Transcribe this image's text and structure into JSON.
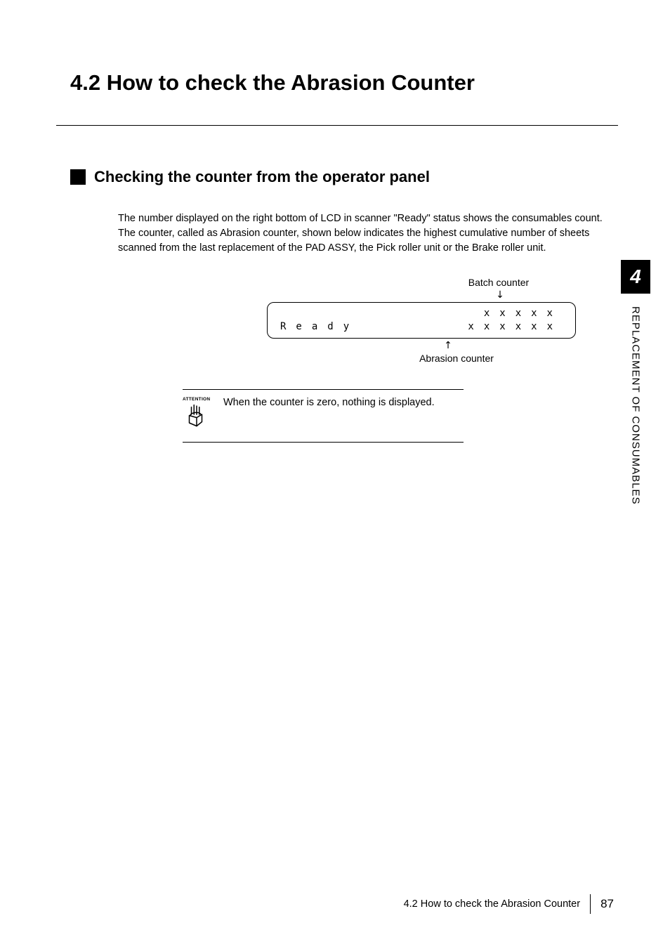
{
  "title": "4.2  How to check the Abrasion Counter",
  "section": {
    "heading": "Checking the counter from the operator panel",
    "paragraph": "The number displayed on the right bottom of LCD in scanner \"Ready\" status shows the consumables count. The counter, called as Abrasion counter, shown below indicates the highest cumulative number of sheets scanned from the last replacement of the PAD ASSY, the Pick roller unit or the Brake roller unit."
  },
  "lcd": {
    "batch_label": "Batch counter",
    "down_arrow": "↓",
    "ready_text": "Ready",
    "row1_right": "xxxxx",
    "row2_right": "xxxxxx",
    "up_arrow": "↑",
    "abrasion_label": "Abrasion counter"
  },
  "attention": {
    "label": "ATTENTION",
    "text": "When the counter is zero, nothing is displayed."
  },
  "sidebar": {
    "chapter_number": "4",
    "chapter_title": "REPLACEMENT OF CONSUMABLES"
  },
  "footer": {
    "section_ref": "4.2  How to check the Abrasion Counter",
    "page_number": "87"
  }
}
